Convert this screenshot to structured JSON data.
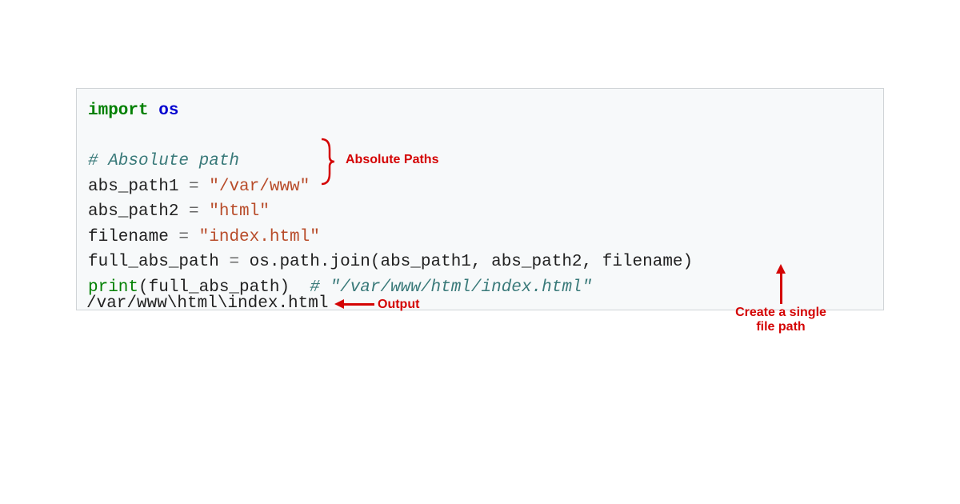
{
  "code": {
    "l1_kw": "import",
    "l1_mod": " os",
    "l2_comment": "# Absolute path",
    "l3_var": "abs_path1 ",
    "l3_eq": "=",
    "l3_str": " \"/var/www\"",
    "l4_var": "abs_path2 ",
    "l4_eq": "=",
    "l4_str": " \"html\"",
    "l5_var": "filename ",
    "l5_eq": "=",
    "l5_str": " \"index.html\"",
    "l6_var": "full_abs_path ",
    "l6_eq": "=",
    "l6_call": " os.path.join(abs_path1, abs_path2, filename)",
    "l7_func": "print",
    "l7_rest": "(full_abs_path)  ",
    "l7_comment": "# \"/var/www/html/index.html\""
  },
  "output": "/var/www\\html\\index.html",
  "annotations": {
    "abs_paths": "Absolute Paths",
    "output_label": "Output",
    "single_path": "Create a single file path"
  }
}
